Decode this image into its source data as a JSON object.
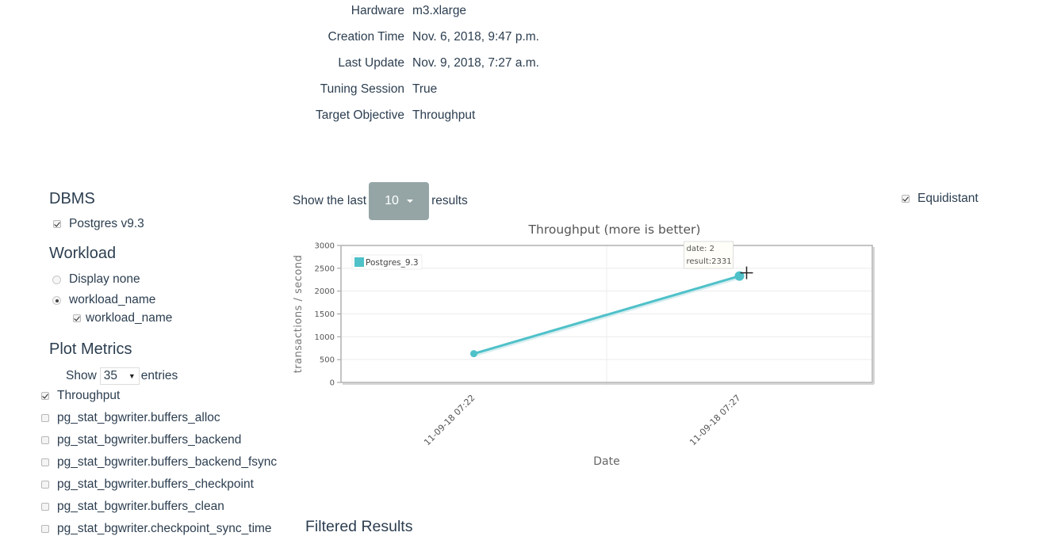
{
  "session_info": [
    {
      "label": "Hardware",
      "value": "m3.xlarge"
    },
    {
      "label": "Creation Time",
      "value": "Nov. 6, 2018, 9:47 p.m."
    },
    {
      "label": "Last Update",
      "value": "Nov. 9, 2018, 7:27 a.m."
    },
    {
      "label": "Tuning Session",
      "value": "True"
    },
    {
      "label": "Target Objective",
      "value": "Throughput"
    }
  ],
  "sidebar": {
    "dbms_heading": "DBMS",
    "dbms_items": [
      {
        "label": "Postgres v9.3",
        "checked": true
      }
    ],
    "workload_heading": "Workload",
    "workload_options": [
      {
        "label": "Display none",
        "selected": false
      },
      {
        "label": "workload_name",
        "selected": true
      }
    ],
    "workload_sub_items": [
      {
        "label": "workload_name",
        "checked": true
      }
    ],
    "plot_metrics_heading": "Plot Metrics",
    "show_label": "Show",
    "entries_value": "35",
    "entries_label": "entries",
    "metrics": [
      {
        "label": "Throughput",
        "checked": true
      },
      {
        "label": "pg_stat_bgwriter.buffers_alloc",
        "checked": false
      },
      {
        "label": "pg_stat_bgwriter.buffers_backend",
        "checked": false
      },
      {
        "label": "pg_stat_bgwriter.buffers_backend_fsync",
        "checked": false
      },
      {
        "label": "pg_stat_bgwriter.buffers_checkpoint",
        "checked": false
      },
      {
        "label": "pg_stat_bgwriter.buffers_clean",
        "checked": false
      },
      {
        "label": "pg_stat_bgwriter.checkpoint_sync_time",
        "checked": false
      }
    ]
  },
  "results_control": {
    "prefix": "Show the last",
    "value": "10",
    "suffix": "results"
  },
  "equidistant": {
    "label": "Equidistant",
    "checked": true
  },
  "filtered_results_heading": "Filtered Results",
  "colors": {
    "series": "#4fc1c9",
    "button": "#95a5a6",
    "text": "#2c3e50"
  },
  "chart_data": {
    "type": "line",
    "title": "Throughput (more is better)",
    "xlabel": "Date",
    "ylabel": "transactions / second",
    "categories": [
      "11-09-18 07:22",
      "11-09-18 07:27"
    ],
    "series": [
      {
        "name": "Postgres_9.3",
        "values": [
          630,
          2331
        ]
      }
    ],
    "ylim": [
      0,
      3000
    ],
    "yticks": [
      0,
      500,
      1000,
      1500,
      2000,
      2500,
      3000
    ],
    "grid": true,
    "legend": "top-left",
    "tooltip": {
      "lines": [
        "date:  2",
        "result:2331"
      ],
      "point_index": 1
    }
  }
}
